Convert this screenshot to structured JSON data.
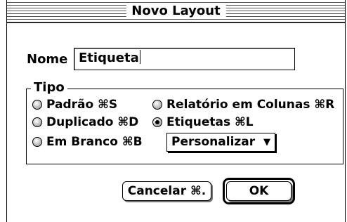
{
  "window": {
    "title": "Novo Layout"
  },
  "name_field": {
    "label": "Nome",
    "value": "Etiqueta"
  },
  "type_group": {
    "label": "Tipo",
    "options": [
      {
        "label": "Padrão ⌘S",
        "selected": false
      },
      {
        "label": "Relatório em Colunas ⌘R",
        "selected": false
      },
      {
        "label": "Duplicado ⌘D",
        "selected": false
      },
      {
        "label": "Etiquetas ⌘L",
        "selected": true
      },
      {
        "label": "Em Branco ⌘B",
        "selected": false
      }
    ],
    "label_popup": {
      "value": "Personalizar"
    }
  },
  "buttons": {
    "cancel": "Cancelar ⌘.",
    "ok": "OK"
  },
  "icons": {
    "radio": "radio-button-icon",
    "popup_arrow": "triangle-down-icon"
  }
}
